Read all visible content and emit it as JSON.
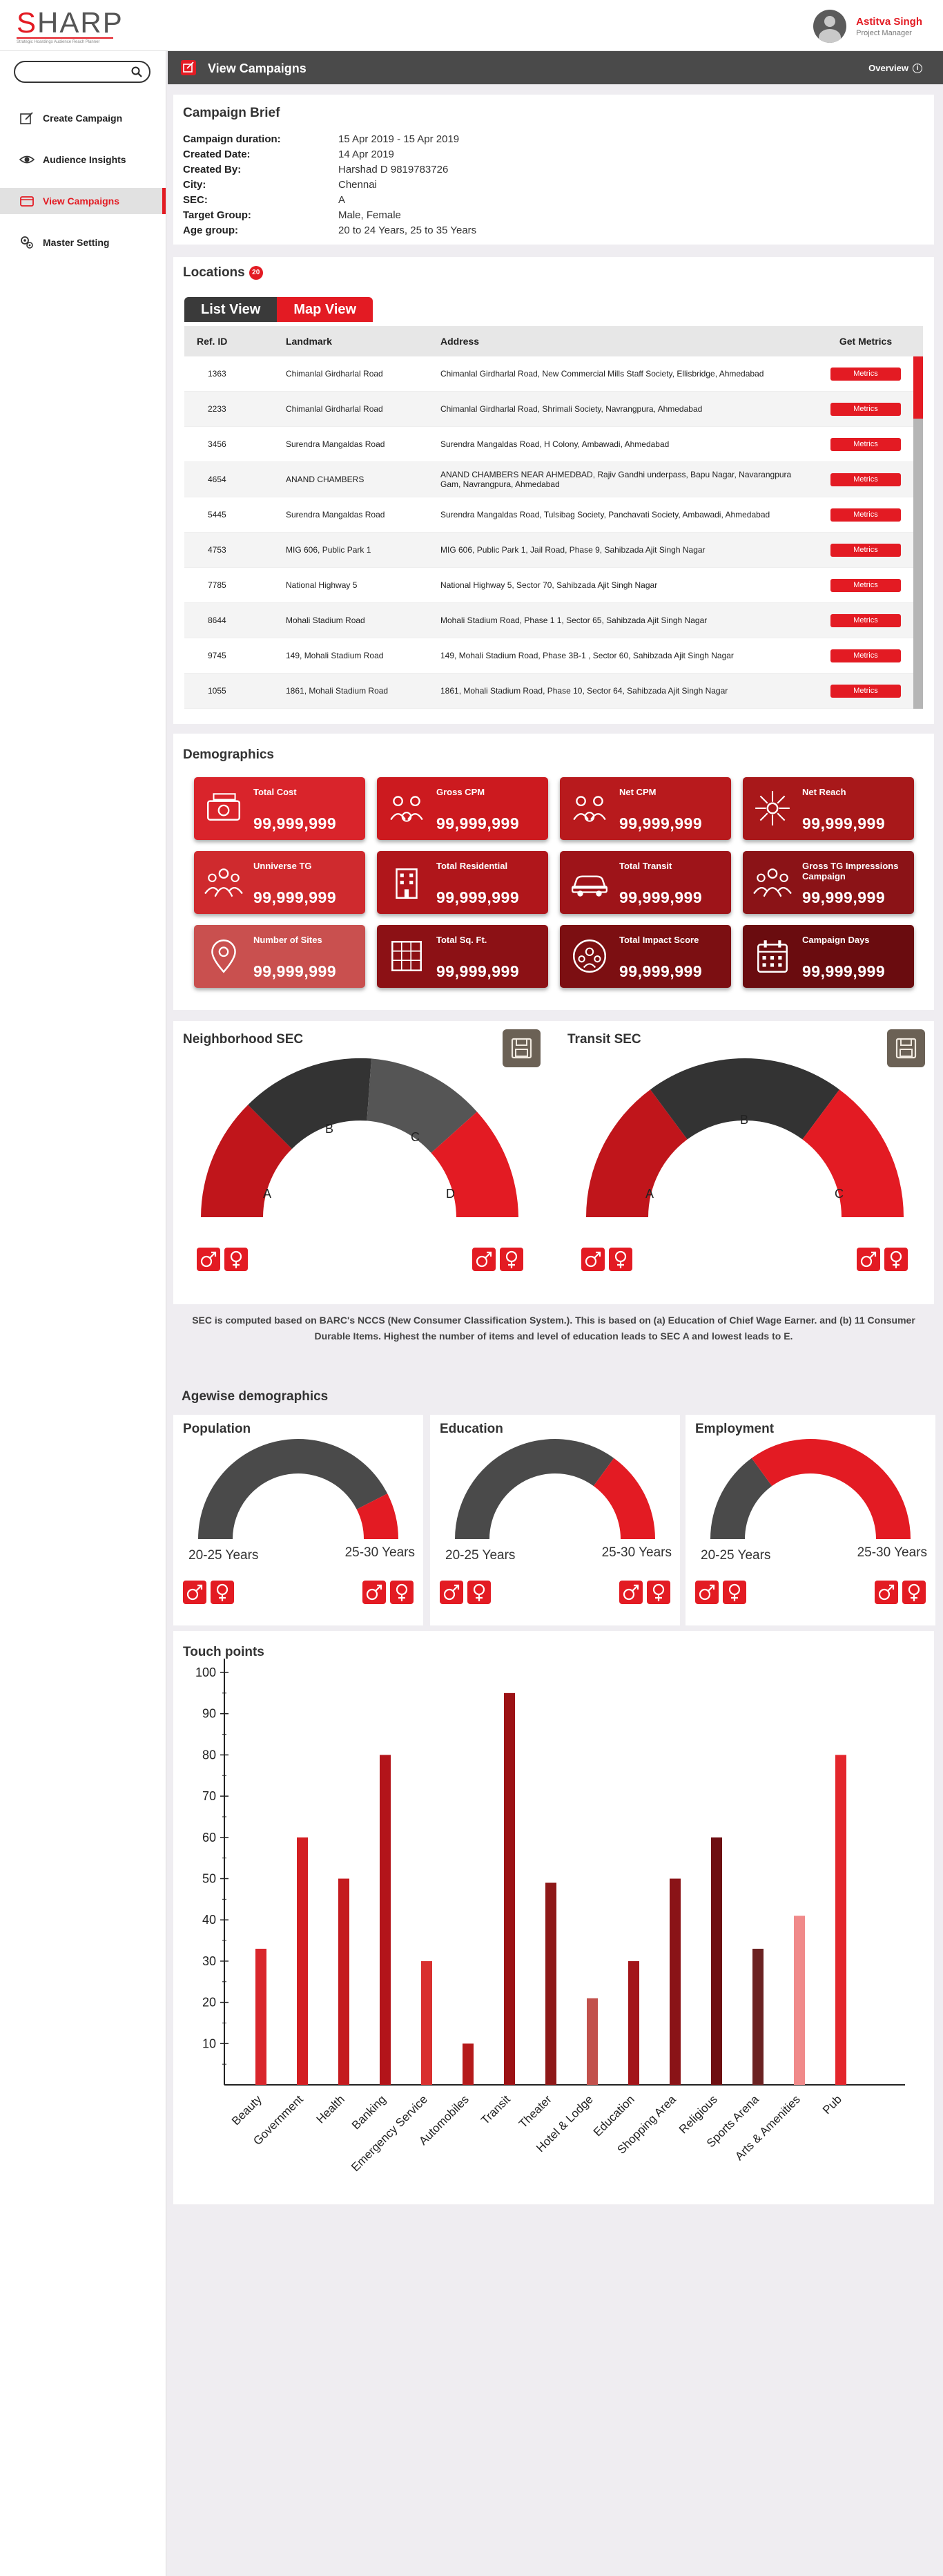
{
  "app": {
    "logo": "SHARP",
    "tagline": "Strategic Hoardings Audience Reach Planner"
  },
  "user": {
    "name": "Astitva Singh",
    "role": "Project Manager"
  },
  "search": {
    "placeholder": ""
  },
  "sidebar": {
    "items": [
      {
        "label": "Create Campaign",
        "icon": "create-campaign-icon"
      },
      {
        "label": "Audience Insights",
        "icon": "eye-icon"
      },
      {
        "label": "View Campaigns",
        "icon": "campaign-icon"
      },
      {
        "label": "Master Setting",
        "icon": "settings-icon"
      }
    ]
  },
  "header": {
    "title": "View Campaigns",
    "overview": "Overview"
  },
  "brief": {
    "title": "Campaign Brief",
    "rows": [
      {
        "k": "Campaign duration:",
        "v": "15 Apr 2019 - 15 Apr 2019"
      },
      {
        "k": "Created Date:",
        "v": "14 Apr 2019"
      },
      {
        "k": "Created By:",
        "v": "Harshad D  9819783726"
      },
      {
        "k": "City:",
        "v": "Chennai"
      },
      {
        "k": "SEC:",
        "v": "A"
      },
      {
        "k": "Target Group:",
        "v": "Male, Female"
      },
      {
        "k": "Age group:",
        "v": "20 to 24 Years, 25 to 35 Years"
      }
    ]
  },
  "locations": {
    "title": "Locations",
    "count": "20",
    "list_view": "List View",
    "map_view": "Map View",
    "headers": [
      "Ref. ID",
      "Landmark",
      "Address",
      "Get Metrics"
    ],
    "metrics_label": "Metrics",
    "rows": [
      {
        "ref": "1363",
        "landmark": "Chimanlal Girdharlal Road",
        "address": "Chimanlal Girdharlal Road, New Commercial Mills Staff Society, Ellisbridge, Ahmedabad"
      },
      {
        "ref": "2233",
        "landmark": "Chimanlal Girdharlal Road",
        "address": "Chimanlal Girdharlal Road, Shrimali Society, Navrangpura, Ahmedabad"
      },
      {
        "ref": "3456",
        "landmark": "Surendra Mangaldas Road",
        "address": "Surendra Mangaldas Road, H Colony, Ambawadi, Ahmedabad"
      },
      {
        "ref": "4654",
        "landmark": "ANAND CHAMBERS",
        "address": "ANAND CHAMBERS NEAR AHMEDBAD, Rajiv Gandhi underpass, Bapu Nagar, Navarangpura Gam, Navrangpura, Ahmedabad"
      },
      {
        "ref": "5445",
        "landmark": "Surendra Mangaldas Road",
        "address": "Surendra Mangaldas Road, Tulsibag Society, Panchavati Society, Ambawadi, Ahmedabad"
      },
      {
        "ref": "4753",
        "landmark": "MIG 606, Public Park 1",
        "address": "MIG 606, Public Park 1, Jail Road, Phase 9, Sahibzada Ajit Singh Nagar"
      },
      {
        "ref": "7785",
        "landmark": "National Highway 5",
        "address": "National Highway 5, Sector 70, Sahibzada Ajit Singh Nagar"
      },
      {
        "ref": "8644",
        "landmark": "Mohali Stadium Road",
        "address": "Mohali Stadium Road, Phase 1 1, Sector 65, Sahibzada Ajit Singh Nagar"
      },
      {
        "ref": "9745",
        "landmark": "149, Mohali Stadium Road",
        "address": "149, Mohali Stadium Road, Phase 3B-1 , Sector 60, Sahibzada Ajit Singh Nagar"
      },
      {
        "ref": "1055",
        "landmark": "1861, Mohali Stadium Road",
        "address": "1861, Mohali Stadium Road, Phase 10, Sector 64, Sahibzada Ajit Singh Nagar"
      }
    ]
  },
  "demographics": {
    "title": "Demographics",
    "tiles": [
      {
        "label": "Total Cost",
        "value": "99,999,999",
        "icon": "money-icon",
        "color": "#d9242b"
      },
      {
        "label": "Gross CPM",
        "value": "99,999,999",
        "icon": "people-money-icon",
        "color": "#cc1a1f"
      },
      {
        "label": "Net CPM",
        "value": "99,999,999",
        "icon": "people-money-icon",
        "color": "#b81a1d"
      },
      {
        "label": "Net Reach",
        "value": "99,999,999",
        "icon": "network-icon",
        "color": "#a8181a"
      },
      {
        "label": "Unniverse TG",
        "value": "99,999,999",
        "icon": "group-icon",
        "color": "#cf2a2e"
      },
      {
        "label": "Total Residential",
        "value": "99,999,999",
        "icon": "building-icon",
        "color": "#b0161b"
      },
      {
        "label": "Total Transit",
        "value": "99,999,999",
        "icon": "car-icon",
        "color": "#9e1419"
      },
      {
        "label": "Gross TG Impressions Campaign",
        "value": "99,999,999",
        "icon": "group-icon",
        "color": "#8b1317"
      },
      {
        "label": "Number of Sites",
        "value": "99,999,999",
        "icon": "location-pin-icon",
        "color": "#c9504f"
      },
      {
        "label": "Total Sq. Ft.",
        "value": "99,999,999",
        "icon": "grid-ruler-icon",
        "color": "#8c1115"
      },
      {
        "label": "Total Impact Score",
        "value": "99,999,999",
        "icon": "impact-icon",
        "color": "#7c0f12"
      },
      {
        "label": "Campaign Days",
        "value": "99,999,999",
        "icon": "calendar-icon",
        "color": "#6a0c0f"
      }
    ]
  },
  "sec": {
    "neighborhood_title": "Neighborhood SEC",
    "transit_title": "Transit SEC",
    "neighborhood_labels": [
      "A",
      "B",
      "C",
      "D"
    ],
    "transit_labels": [
      "A",
      "B",
      "C"
    ],
    "note": "SEC is computed based on BARC's NCCS (New Consumer Classification System.). This is based on (a) Education of Chief Wage Earner. and (b) 11 Consumer Durable Items. Highest the number of items and level of education leads to SEC A and lowest leads to E."
  },
  "agewise": {
    "title": "Agewise demographics",
    "cards": [
      {
        "title": "Population",
        "left": "20-25 Years",
        "right": "25-30 Years",
        "share": 0.15
      },
      {
        "title": "Education",
        "left": "20-25 Years",
        "right": "25-30 Years",
        "share": 0.3
      },
      {
        "title": "Employment",
        "left": "20-25 Years",
        "right": "25-30 Years",
        "share": 0.7
      }
    ]
  },
  "chart_data": {
    "type": "bar",
    "title": "Touch points",
    "categories": [
      "Beauty",
      "Government",
      "Health",
      "Banking",
      "Emergency Service",
      "Automobiles",
      "Transit",
      "Theater",
      "Hotel & Lodge",
      "Education",
      "Shopping Area",
      "Religious",
      "Sports Arena",
      "Arts & Amenities",
      "Pub"
    ],
    "values": [
      33,
      60,
      50,
      80,
      30,
      10,
      95,
      49,
      21,
      30,
      50,
      60,
      33,
      41,
      80
    ],
    "colors": [
      "#d9262c",
      "#d31e22",
      "#c41b1f",
      "#b3141a",
      "#d9302f",
      "#b51a1b",
      "#9c1215",
      "#8e1818",
      "#c2514c",
      "#a3151a",
      "#8a1317",
      "#6e0f12",
      "#6b2222",
      "#f08a8a",
      "#e3262c"
    ],
    "ylim": [
      0,
      100
    ],
    "yticks": [
      10,
      20,
      30,
      40,
      50,
      60,
      70,
      80,
      90,
      100
    ],
    "grid": false
  }
}
